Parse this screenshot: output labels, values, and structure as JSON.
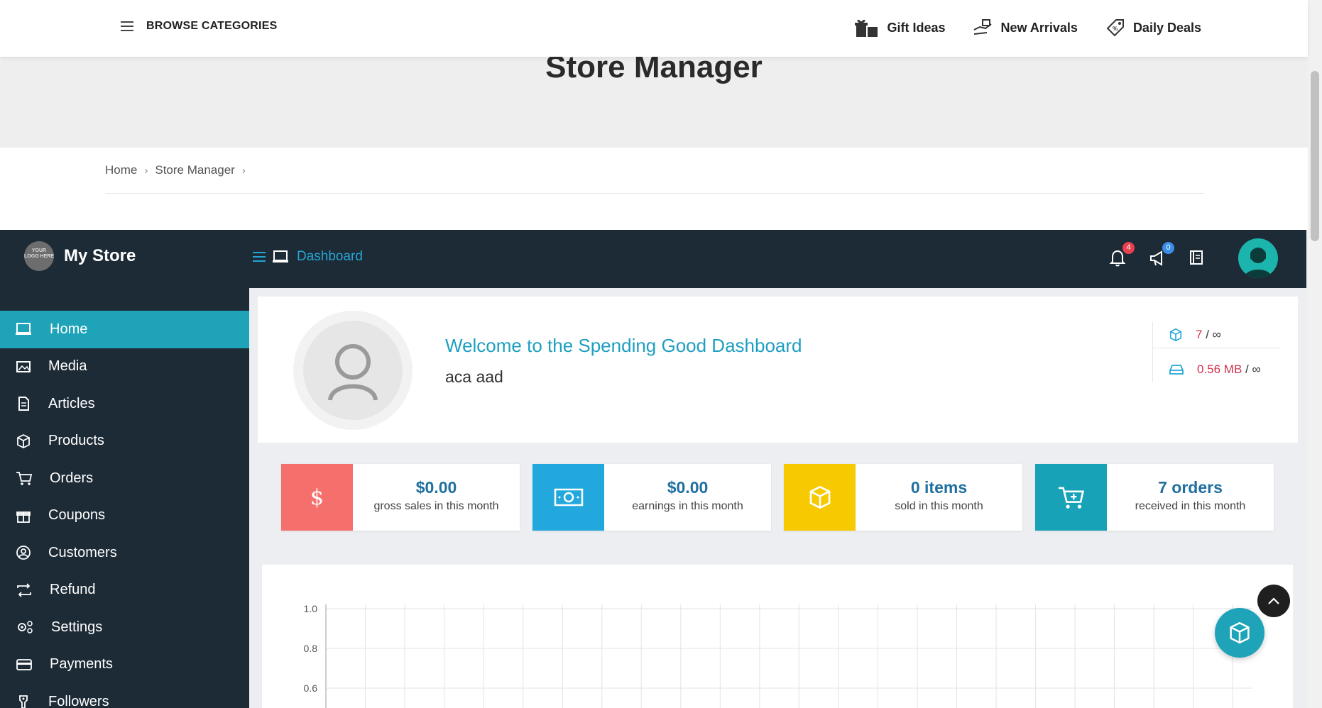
{
  "topbar": {
    "browse_label": "BROWSE CATEGORIES",
    "nav": [
      {
        "label": "Gift Ideas",
        "icon": "gift-icon"
      },
      {
        "label": "New Arrivals",
        "icon": "hand-delivery-icon"
      },
      {
        "label": "Daily Deals",
        "icon": "price-tag-icon"
      }
    ]
  },
  "banner": {
    "title": "Store Manager"
  },
  "breadcrumb": {
    "items": [
      "Home",
      "Store Manager"
    ]
  },
  "dashboard_header": {
    "store_name": "My Store",
    "logo_text": "YOUR LOGO HERE",
    "current_page": "Dashboard",
    "notifications_count": "4",
    "announcements_count": "0"
  },
  "sidebar": {
    "items": [
      {
        "label": "Home",
        "icon": "monitor-icon",
        "active": true
      },
      {
        "label": "Media",
        "icon": "image-icon"
      },
      {
        "label": "Articles",
        "icon": "document-icon"
      },
      {
        "label": "Products",
        "icon": "cube-icon"
      },
      {
        "label": "Orders",
        "icon": "cart-icon"
      },
      {
        "label": "Coupons",
        "icon": "gift-icon"
      },
      {
        "label": "Customers",
        "icon": "user-circle-icon"
      },
      {
        "label": "Refund",
        "icon": "refund-arrows-icon"
      },
      {
        "label": "Settings",
        "icon": "gears-icon"
      },
      {
        "label": "Payments",
        "icon": "credit-card-icon"
      },
      {
        "label": "Followers",
        "icon": "followers-icon"
      }
    ]
  },
  "welcome": {
    "title": "Welcome to the Spending Good Dashboard",
    "user": "aca aad",
    "products_quota": {
      "value": "7",
      "limit": "∞"
    },
    "storage_quota": {
      "value": "0.56 MB",
      "limit": "∞"
    }
  },
  "stats": [
    {
      "value": "$0.00",
      "label": "gross sales in this month",
      "color": "#f56f6c",
      "icon": "dollar-icon"
    },
    {
      "value": "$0.00",
      "label": "earnings in this month",
      "color": "#22a8dc",
      "icon": "money-icon"
    },
    {
      "value": "0 items",
      "label": "sold in this month",
      "color": "#f6c900",
      "icon": "cube-icon"
    },
    {
      "value": "7 orders",
      "label": "received in this month",
      "color": "#18a2b8",
      "icon": "cart-plus-icon"
    }
  ],
  "chart_data": {
    "type": "line",
    "y_ticks": [
      "1.0",
      "0.8",
      "0.6"
    ],
    "ylim": [
      0.6,
      1.0
    ],
    "x_gridlines": 24,
    "grid": true
  },
  "colors": {
    "dark": "#1d2b36",
    "accent": "#1ea3b8",
    "link": "#25a6d6"
  }
}
